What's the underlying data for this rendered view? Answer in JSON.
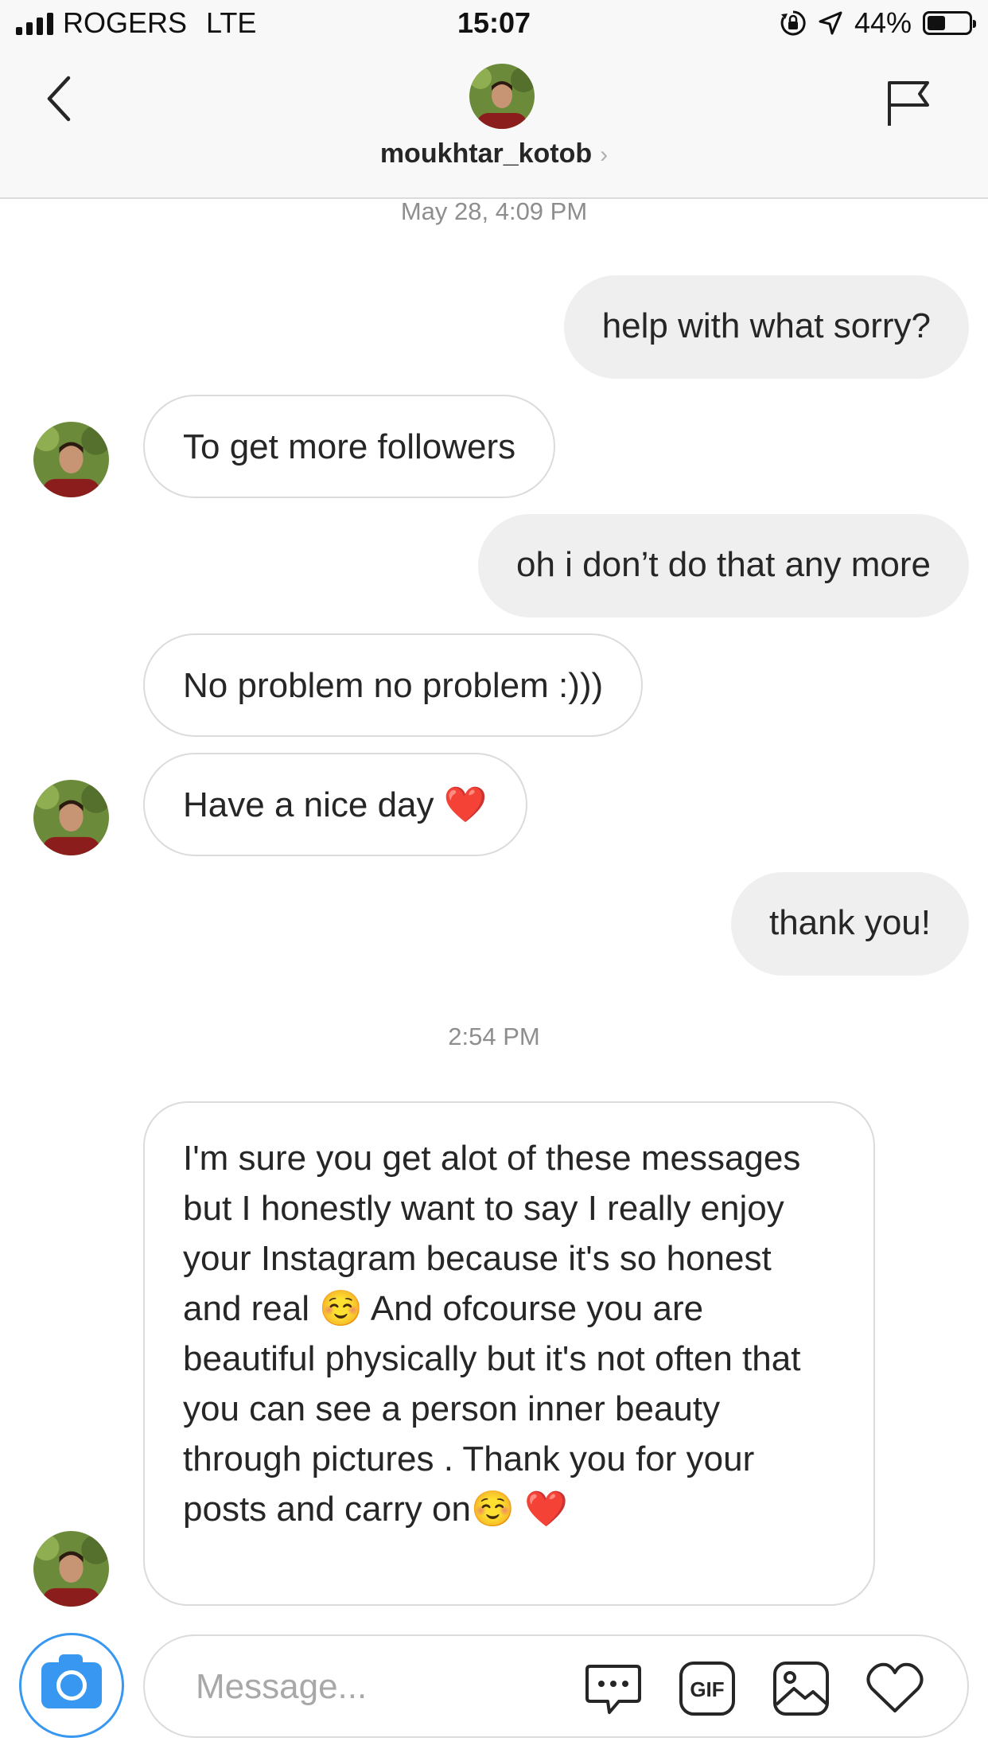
{
  "status_bar": {
    "carrier": "ROGERS",
    "network": "LTE",
    "time": "15:07",
    "battery": "44%",
    "battery_level": 0.44
  },
  "header": {
    "username": "moukhtar_kotob",
    "chevron": "›",
    "back_icon": "chevron-left-icon",
    "report_icon": "flag-icon"
  },
  "thread": {
    "timestamps": [
      "May 28, 4:09 PM",
      "2:54 PM"
    ],
    "messages": [
      {
        "from": "me",
        "text": "help with what sorry?"
      },
      {
        "from": "them",
        "text": "To get more followers"
      },
      {
        "from": "me",
        "text": "oh i don’t do that any more"
      },
      {
        "from": "them",
        "text": "No problem no problem :)))"
      },
      {
        "from": "them",
        "text": "Have a nice day ❤️"
      },
      {
        "from": "me",
        "text": "thank you!"
      },
      {
        "from": "them",
        "text": "I'm sure you get alot of these messages but I honestly want to say I really enjoy your Instagram because it's so honest and real ☺️ And ofcourse you are beautiful physically but it's not often that you can see a person inner beauty through pictures . Thank you for your posts and carry on☺️ ❤️"
      }
    ]
  },
  "composer": {
    "placeholder": "Message...",
    "icons": [
      "camera-icon",
      "sticker-icon",
      "gif-icon",
      "gallery-icon",
      "heart-icon"
    ]
  },
  "colors": {
    "accent": "#3897f0",
    "bubble_out": "#efefef",
    "border": "#dbdbdb",
    "muted": "#8e8e8e"
  }
}
